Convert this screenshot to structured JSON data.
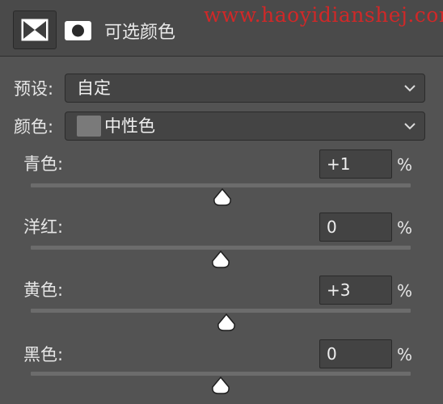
{
  "header": {
    "title": "可选颜色",
    "watermark": "www.haoyidianshej.com",
    "adjustment_icon": "selective-color-icon",
    "mask_icon": "layer-mask-icon"
  },
  "preset": {
    "label": "预设:",
    "value": "自定"
  },
  "colors": {
    "label": "颜色:",
    "value": "中性色",
    "swatch_color": "#7a7a7a"
  },
  "sliders": [
    {
      "label": "青色:",
      "value": "+1",
      "unit": "%",
      "percent": 1
    },
    {
      "label": "洋红:",
      "value": "0",
      "unit": "%",
      "percent": 0
    },
    {
      "label": "黄色:",
      "value": "+3",
      "unit": "%",
      "percent": 3
    },
    {
      "label": "黑色:",
      "value": "0",
      "unit": "%",
      "percent": 0
    }
  ],
  "colors_theme": {
    "panel_bg": "#535353",
    "watermark": "#d02828"
  }
}
